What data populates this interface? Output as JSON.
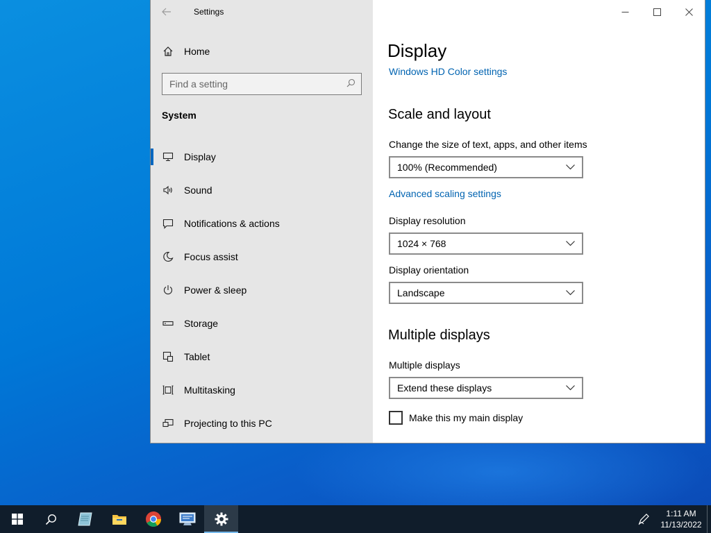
{
  "window": {
    "title": "Settings",
    "controls": {
      "minimize": "—",
      "maximize": "☐",
      "close": "✕"
    }
  },
  "sidebar": {
    "home_label": "Home",
    "search_placeholder": "Find a setting",
    "section_title": "System",
    "items": [
      {
        "label": "Display",
        "icon": "monitor-icon",
        "active": true
      },
      {
        "label": "Sound",
        "icon": "speaker-icon"
      },
      {
        "label": "Notifications & actions",
        "icon": "notification-icon"
      },
      {
        "label": "Focus assist",
        "icon": "moon-icon"
      },
      {
        "label": "Power & sleep",
        "icon": "power-icon"
      },
      {
        "label": "Storage",
        "icon": "storage-icon"
      },
      {
        "label": "Tablet",
        "icon": "tablet-icon"
      },
      {
        "label": "Multitasking",
        "icon": "multitasking-icon"
      },
      {
        "label": "Projecting to this PC",
        "icon": "projecting-icon"
      }
    ]
  },
  "main": {
    "title": "Display",
    "hd_color_link": "Windows HD Color settings",
    "scale_section": "Scale and layout",
    "scale_label": "Change the size of text, apps, and other items",
    "scale_value": "100% (Recommended)",
    "advanced_scaling_link": "Advanced scaling settings",
    "resolution_label": "Display resolution",
    "resolution_value": "1024 × 768",
    "orientation_label": "Display orientation",
    "orientation_value": "Landscape",
    "multiple_section": "Multiple displays",
    "multiple_label": "Multiple displays",
    "multiple_value": "Extend these displays",
    "main_display_checkbox": "Make this my main display",
    "main_display_checked": false
  },
  "taskbar": {
    "apps": [
      "start-icon",
      "search-icon",
      "notepad-icon",
      "file-explorer-icon",
      "chrome-icon",
      "remote-desktop-icon",
      "settings-gear-icon"
    ],
    "time": "1:11 AM",
    "date": "11/13/2022"
  },
  "colors": {
    "accent": "#0067c0",
    "link": "#0063b1",
    "sidebar_bg": "#e6e6e6",
    "taskbar_bg": "#101d2b",
    "desktop": "#0078d7"
  }
}
